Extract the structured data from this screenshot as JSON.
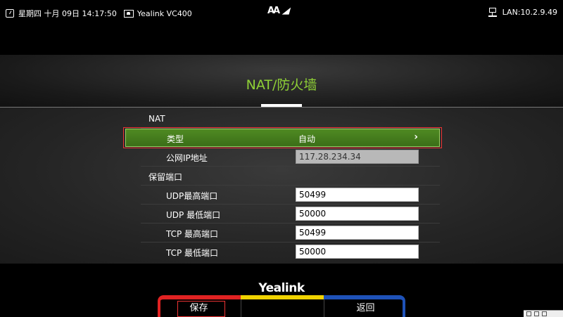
{
  "statusbar": {
    "datetime": "星期四 十月 09日 14:17:50",
    "device": "Yealink VC400",
    "font_toggle": "AA",
    "network": "LAN:10.2.9.49"
  },
  "page": {
    "title": "NAT/防火墙"
  },
  "nat": {
    "section_label": "NAT",
    "type_label": "类型",
    "type_value": "自动",
    "public_ip_label": "公网IP地址",
    "public_ip_value": "117.28.234.34"
  },
  "ports": {
    "section_label": "保留端口",
    "udp_max_label": "UDP最高端口",
    "udp_max_value": "50499",
    "udp_min_label": "UDP 最低端口",
    "udp_min_value": "50000",
    "tcp_max_label": "TCP 最高端口",
    "tcp_max_value": "50499",
    "tcp_min_label": "TCP 最低端口",
    "tcp_min_value": "50000"
  },
  "footer": {
    "brand": "Yealink",
    "save_label": "保存",
    "middle_label": "",
    "back_label": "返回"
  },
  "colors": {
    "title_green": "#8fd136",
    "selected_row": "#4f8a22",
    "softkey_red": "#e02222",
    "softkey_yellow": "#f1d300",
    "softkey_blue": "#1e52b8",
    "focus_outline": "#e33333"
  }
}
